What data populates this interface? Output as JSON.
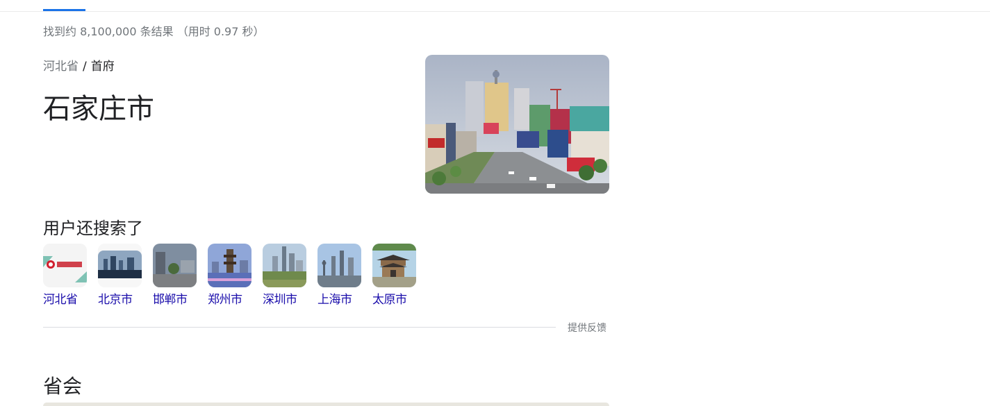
{
  "header": {
    "result_stats": "找到约 8,100,000 条结果 （用时 0.97 秒）"
  },
  "entity": {
    "breadcrumb_parent": "河北省",
    "breadcrumb_separator": "/",
    "breadcrumb_type": "首府",
    "title": "石家庄市"
  },
  "related": {
    "heading": "用户还搜索了",
    "items": [
      {
        "label": "河北省"
      },
      {
        "label": "北京市"
      },
      {
        "label": "邯郸市"
      },
      {
        "label": "郑州市"
      },
      {
        "label": "深圳市"
      },
      {
        "label": "上海市"
      },
      {
        "label": "太原市"
      }
    ]
  },
  "feedback": {
    "label": "提供反馈"
  },
  "section2": {
    "heading": "省会"
  },
  "colors": {
    "accent": "#1a73e8",
    "link": "#1a0dab",
    "muted_text": "#70757a"
  }
}
